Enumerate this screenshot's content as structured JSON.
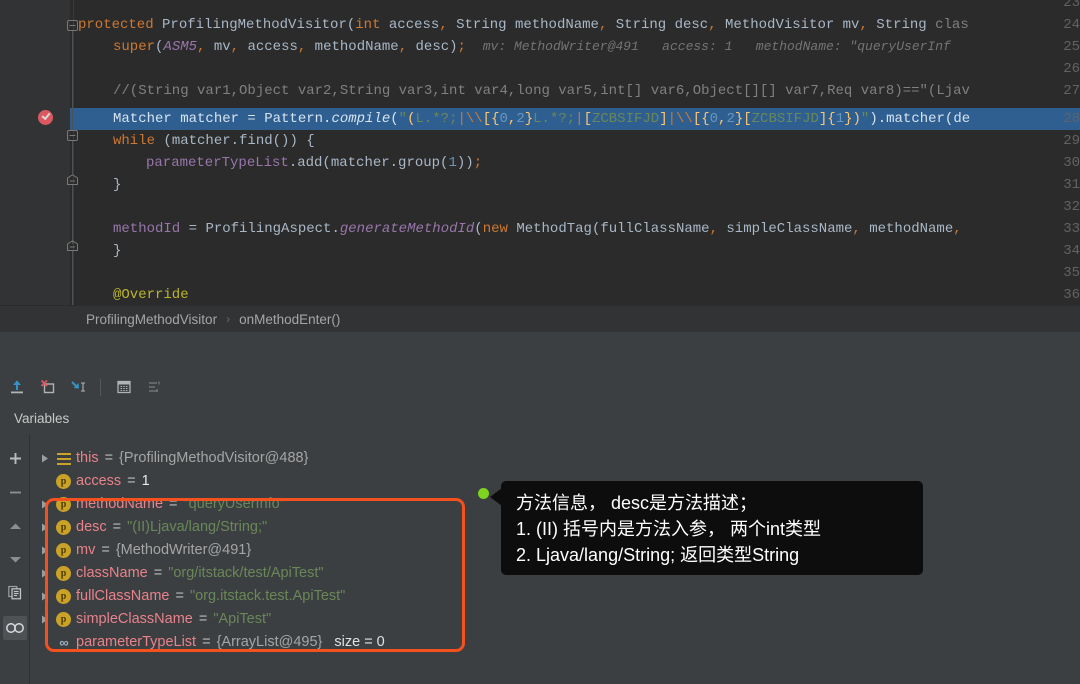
{
  "editor": {
    "first_line_number": 23,
    "breakpoint_line": 28,
    "highlighted_line": 28,
    "lines": [
      {
        "n": 23,
        "text": ""
      },
      {
        "n": 24,
        "text": "protected ProfilingMethodVisitor(int access, String methodName, String desc, MethodVisitor mv, String clas"
      },
      {
        "n": 25,
        "text": "super(ASM5, mv, access, methodName, desc);",
        "hint": "mv: MethodWriter@491   access: 1   methodName: \"queryUserInf"
      },
      {
        "n": 26,
        "text": ""
      },
      {
        "n": 27,
        "text": "//(String var1,Object var2,String var3,int var4,long var5,int[] var6,Object[][] var7,Req var8)==\"(Ljav"
      },
      {
        "n": 28,
        "text": "Matcher matcher = Pattern.compile(\"(L.*?;|\\\\[{0,2}L.*?;|[ZCBSIFJD]|\\\\[{0,2}[ZCBSIFJD]{1})\").matcher(de"
      },
      {
        "n": 29,
        "text": "while (matcher.find()) {"
      },
      {
        "n": 30,
        "text": "parameterTypeList.add(matcher.group(1));"
      },
      {
        "n": 31,
        "text": "}"
      },
      {
        "n": 32,
        "text": ""
      },
      {
        "n": 33,
        "text": "methodId = ProfilingAspect.generateMethodId(new MethodTag(fullClassName, simpleClassName, methodName,"
      },
      {
        "n": 34,
        "text": "}"
      },
      {
        "n": 35,
        "text": ""
      },
      {
        "n": 36,
        "text": "@Override"
      }
    ]
  },
  "breadcrumb": {
    "class": "ProfilingMethodVisitor",
    "separator": "›",
    "method": "onMethodEnter()"
  },
  "debug_toolbar": {
    "buttons": [
      {
        "name": "step-out-icon",
        "title": "Step Out"
      },
      {
        "name": "force-step-over-icon",
        "title": "Force Step Over"
      },
      {
        "name": "step-into-icon",
        "title": "Step Into"
      },
      {
        "name": "evaluate-expression-icon",
        "title": "Evaluate Expression"
      },
      {
        "name": "settings-list-icon",
        "title": "Layout Settings"
      }
    ]
  },
  "tabs": {
    "variables_label": "Variables"
  },
  "vars_toolbar": {
    "buttons": [
      {
        "name": "add-watch-icon",
        "glyph": "+"
      },
      {
        "name": "remove-watch-icon",
        "glyph": "−"
      },
      {
        "name": "move-up-icon",
        "glyph": "▲"
      },
      {
        "name": "move-down-icon",
        "glyph": "▼"
      },
      {
        "name": "copy-value-icon",
        "glyph": "❐"
      },
      {
        "name": "watches-icon",
        "glyph": "∞",
        "active": true
      }
    ]
  },
  "variables": [
    {
      "icon": "list",
      "expandable": true,
      "name": "this",
      "eq": "=",
      "value": "{ProfilingMethodVisitor@488}",
      "value_kind": "object",
      "in_box": false
    },
    {
      "icon": "p",
      "expandable": false,
      "name": "access",
      "eq": "=",
      "value": "1",
      "value_kind": "number",
      "in_box": false
    },
    {
      "icon": "p",
      "expandable": true,
      "name": "methodName",
      "eq": "=",
      "value": "\"queryUserInfo\"",
      "value_kind": "string",
      "in_box": true
    },
    {
      "icon": "p",
      "expandable": true,
      "name": "desc",
      "eq": "=",
      "value": "\"(II)Ljava/lang/String;\"",
      "value_kind": "string",
      "in_box": true
    },
    {
      "icon": "p",
      "expandable": true,
      "name": "mv",
      "eq": "=",
      "value": "{MethodWriter@491}",
      "value_kind": "object",
      "in_box": true
    },
    {
      "icon": "p",
      "expandable": true,
      "name": "className",
      "eq": "=",
      "value": "\"org/itstack/test/ApiTest\"",
      "value_kind": "string",
      "in_box": true
    },
    {
      "icon": "p",
      "expandable": true,
      "name": "fullClassName",
      "eq": "=",
      "value": "\"org.itstack.test.ApiTest\"",
      "value_kind": "string",
      "in_box": true
    },
    {
      "icon": "p",
      "expandable": true,
      "name": "simpleClassName",
      "eq": "=",
      "value": "\"ApiTest\"",
      "value_kind": "string",
      "in_box": true
    },
    {
      "icon": "oo",
      "expandable": false,
      "name": "parameterTypeList",
      "eq": "=",
      "value": "{ArrayList@495}",
      "value_kind": "object",
      "extra": "size = 0",
      "in_box": false
    }
  ],
  "annotation": {
    "lines": [
      "方法信息， desc是方法描述；",
      "1. (II) 括号内是方法入参， 两个int类型",
      "2. Ljava/lang/String; 返回类型String"
    ],
    "marker_color": "#7ed321",
    "box_color": "#f4511e",
    "background": "#0d0d0d"
  },
  "colors": {
    "editor_bg": "#2b2b2b",
    "gutter_bg": "#313335",
    "panel_bg": "#3c3f41",
    "selection": "#2f5f91",
    "accent_orange": "#f4511e",
    "breakpoint": "#db5860",
    "string_green": "#6a8759",
    "var_name_red": "#e8828b",
    "keyword_orange": "#cc7832"
  }
}
